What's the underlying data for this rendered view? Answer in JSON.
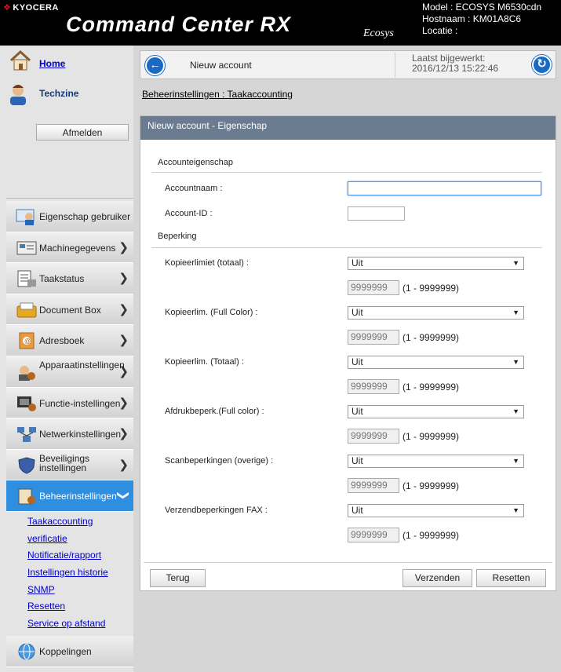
{
  "header": {
    "brand": "KYOCERA",
    "product": "Command Center RX",
    "ecosys": "Ecosys",
    "model": "Model : ECOSYS M6530cdn",
    "hostname": "Hostnaam : KM01A8C6",
    "location": "Locatie :"
  },
  "sidebar": {
    "home": "Home",
    "user": "Techzine",
    "logout": "Afmelden",
    "menu": [
      {
        "label": "Eigenschap gebruiker",
        "icon": "user-property-icon"
      },
      {
        "label": "Machinegegevens",
        "icon": "machine-info-icon"
      },
      {
        "label": "Taakstatus",
        "icon": "job-status-icon"
      },
      {
        "label": "Document Box",
        "icon": "document-box-icon"
      },
      {
        "label": "Adresboek",
        "icon": "address-book-icon"
      },
      {
        "label": "Apparaatinstellingen",
        "icon": "device-settings-icon"
      },
      {
        "label": "Functie-instellingen",
        "icon": "function-settings-icon"
      },
      {
        "label": "Netwerkinstellingen",
        "icon": "network-settings-icon"
      },
      {
        "label": "Beveiligings instellingen",
        "icon": "security-shield-icon"
      },
      {
        "label": "Beheerinstellingen",
        "icon": "management-settings-icon"
      }
    ],
    "submenu": [
      "Taakaccounting",
      "verificatie",
      "Notificatie/rapport",
      "Instellingen historie",
      "SNMP",
      "Resetten",
      "Service op afstand"
    ],
    "links": "Koppelingen"
  },
  "topbar": {
    "title": "Nieuw account",
    "updated_label": "Laatst bijgewerkt:",
    "updated_value": "2016/12/13 15:22:46"
  },
  "breadcrumb": "Beheerinstellingen : Taakaccounting",
  "panel": {
    "title": "Nieuw account - Eigenschap",
    "section_account": "Accounteigenschap",
    "account_name_label": "Accountnaam :",
    "account_name_value": "",
    "account_id_label": "Account-ID :",
    "account_id_value": "",
    "section_restriction": "Beperking",
    "restrictions": [
      {
        "label": "Kopieerlimiet (totaal) :",
        "select": "Uit",
        "limit": "9999999",
        "range": "(1 - 9999999)"
      },
      {
        "label": "Kopieerlim. (Full Color) :",
        "select": "Uit",
        "limit": "9999999",
        "range": "(1 - 9999999)"
      },
      {
        "label": "Kopieerlim. (Totaal) :",
        "select": "Uit",
        "limit": "9999999",
        "range": "(1 - 9999999)"
      },
      {
        "label": "Afdrukbeperk.(Full color) :",
        "select": "Uit",
        "limit": "9999999",
        "range": "(1 - 9999999)"
      },
      {
        "label": "Scanbeperkingen (overige) :",
        "select": "Uit",
        "limit": "9999999",
        "range": "(1 - 9999999)"
      },
      {
        "label": "Verzendbeperkingen FAX :",
        "select": "Uit",
        "limit": "9999999",
        "range": "(1 - 9999999)"
      }
    ],
    "back_button": "Terug",
    "submit_button": "Verzenden",
    "reset_button": "Resetten"
  }
}
